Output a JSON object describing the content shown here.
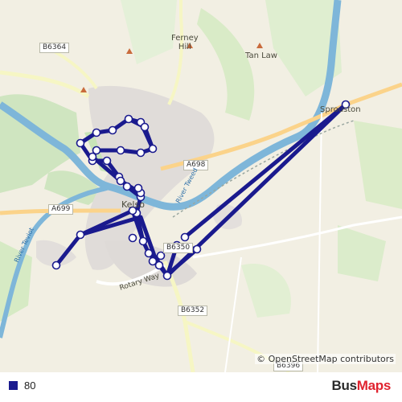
{
  "map": {
    "places": [
      {
        "id": "ferney-hill",
        "text": "Ferney\nHill"
      },
      {
        "id": "tan-law",
        "text": "Tan Law"
      },
      {
        "id": "sprouston",
        "text": "Sprouston"
      },
      {
        "id": "kelso",
        "text": "Kelso"
      }
    ],
    "roads": [
      {
        "id": "b6364",
        "text": "B6364"
      },
      {
        "id": "a698",
        "text": "A698"
      },
      {
        "id": "a699",
        "text": "A699"
      },
      {
        "id": "b6350",
        "text": "B6350"
      },
      {
        "id": "b6352",
        "text": "B6352"
      },
      {
        "id": "b6396",
        "text": "B6396"
      },
      {
        "id": "rotary-way",
        "text": "Rotary Way"
      }
    ],
    "rivers": [
      {
        "id": "river-tweed",
        "text": "River Tweed"
      },
      {
        "id": "river-teviot",
        "text": "River Teviot"
      }
    ],
    "attribution": "© OpenStreetMap contributors",
    "route_color": "#1a1a8e"
  },
  "legend": {
    "route_label": "80",
    "swatch_color": "#1a1a8e"
  },
  "brand": {
    "part1": "Bus",
    "part2": "Maps"
  }
}
